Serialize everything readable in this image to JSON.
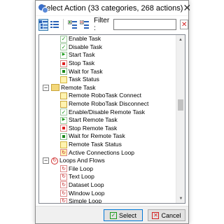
{
  "window": {
    "title": "Select Action (33 categories, 268 actions)",
    "close_glyph": "✕"
  },
  "toolbar": {
    "filter_label": "Filter :",
    "filter_value": "",
    "clear_glyph": "✕"
  },
  "tree": {
    "items": [
      {
        "label": "Enable Task",
        "icon": "check-icon",
        "level": "child"
      },
      {
        "label": "Disable Task",
        "icon": "check-icon",
        "level": "child"
      },
      {
        "label": "Start Task",
        "icon": "play-icon",
        "level": "child"
      },
      {
        "label": "Stop Task",
        "icon": "stop-icon",
        "level": "child"
      },
      {
        "label": "Wait for Task",
        "icon": "wait-icon",
        "level": "child"
      },
      {
        "label": "Task Status",
        "icon": "status-icon",
        "level": "child"
      },
      {
        "label": "Remote Task",
        "icon": "folder-icon",
        "level": "category",
        "expander": "−"
      },
      {
        "label": "Remote RoboTask Connect",
        "icon": "remote-icon",
        "level": "child"
      },
      {
        "label": "Remote RoboTask Disconnect",
        "icon": "remote-icon",
        "level": "child"
      },
      {
        "label": "Enable/Disable Remote Task",
        "icon": "check-icon",
        "level": "child"
      },
      {
        "label": "Start Remote Task",
        "icon": "play-icon",
        "level": "child"
      },
      {
        "label": "Stop Remote Task",
        "icon": "stop-icon",
        "level": "child"
      },
      {
        "label": "Wait for Remote Task",
        "icon": "wait-icon",
        "level": "child"
      },
      {
        "label": "Remote Task Status",
        "icon": "status-icon",
        "level": "child"
      },
      {
        "label": "Active Connections Loop",
        "icon": "connections-loop-icon",
        "level": "child"
      },
      {
        "label": "Loops And Flows",
        "icon": "loop-category-icon",
        "level": "category",
        "expander": "−"
      },
      {
        "label": "File Loop",
        "icon": "loop-icon",
        "level": "child"
      },
      {
        "label": "Text Loop",
        "icon": "loop-icon",
        "level": "child"
      },
      {
        "label": "Dataset Loop",
        "icon": "loop-icon",
        "level": "child"
      },
      {
        "label": "Window Loop",
        "icon": "loop-icon",
        "level": "child"
      },
      {
        "label": "Simple Loop",
        "icon": "loop-icon",
        "level": "child"
      }
    ]
  },
  "footer": {
    "select_label": "Select",
    "cancel_label": "Cancel"
  },
  "colors": {
    "accent": "#0078d7",
    "check_green": "#1a9b1a",
    "stop_red": "#e02020"
  }
}
